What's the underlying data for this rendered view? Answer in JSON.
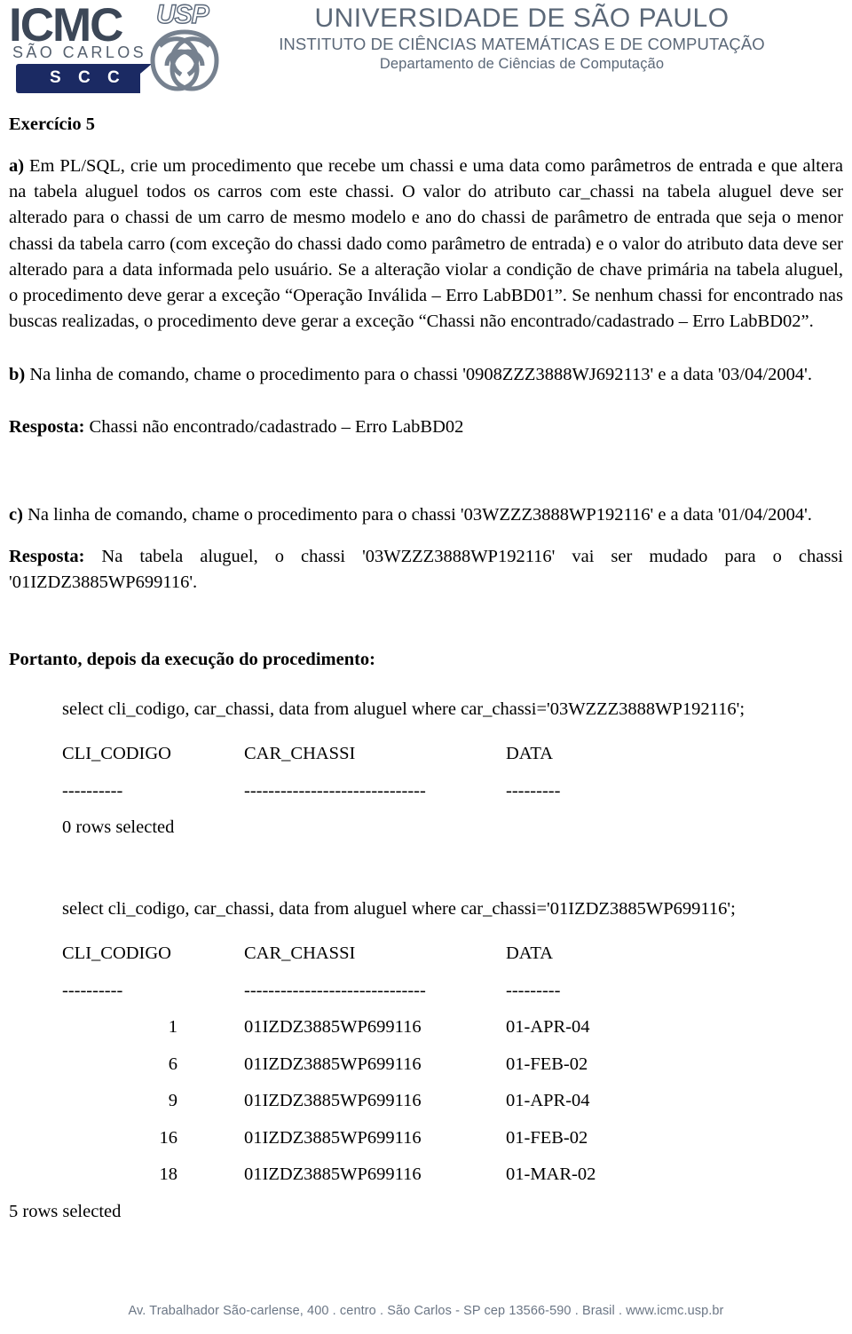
{
  "header": {
    "logo": {
      "icmc": "ICMC",
      "campus": "SÃO CARLOS",
      "department_badge": "S C C",
      "usp": "USP"
    },
    "line1": "UNIVERSIDADE DE SÃO PAULO",
    "line2": "INSTITUTO DE CIÊNCIAS MATEMÁTICAS E DE COMPUTAÇÃO",
    "line3": "Departamento de Ciências de Computação",
    "colors": {
      "title_gray_blue": "#5b6878",
      "logo_navy": "#1b2a63",
      "logo_slate": "#3c4757"
    }
  },
  "exercise": {
    "title": "Exercício 5",
    "item_a": {
      "label": "a)",
      "text": " Em PL/SQL, crie um procedimento que recebe um chassi e uma data como parâmetros de entrada e que altera na tabela aluguel todos os carros com este chassi. O valor do atributo car_chassi na tabela aluguel deve ser alterado para o chassi de um carro de mesmo modelo e ano do chassi de parâmetro de entrada que seja o menor chassi da tabela carro (com exceção do chassi dado como parâmetro de entrada) e o valor do atributo data deve ser alterado para a data informada pelo usuário. Se a alteração violar a condição de chave primária na tabela aluguel, o procedimento deve gerar a exceção “Operação Inválida – Erro LabBD01”. Se nenhum chassi for encontrado nas buscas realizadas, o procedimento deve gerar a exceção “Chassi não encontrado/cadastrado – Erro LabBD02”."
    },
    "item_b": {
      "label": "b)",
      "text": " Na linha de comando, chame o procedimento para o chassi  '0908ZZZ3888WJ692113' e a data '03/04/2004'.",
      "answer_label": "Resposta:",
      "answer_text": " Chassi não encontrado/cadastrado – Erro LabBD02"
    },
    "item_c": {
      "label": "c)",
      "text": " Na linha de comando, chame o procedimento para o chassi '03WZZZ3888WP192116' e a data '01/04/2004'.",
      "answer_label": "Resposta:",
      "answer_text": " Na tabela aluguel, o chassi '03WZZZ3888WP192116' vai ser mudado para o chassi '01IZDZ3885WP699116'."
    },
    "after_note": "Portanto, depois da execução do procedimento:"
  },
  "query1": {
    "statement": "select cli_codigo, car_chassi, data from aluguel where car_chassi='03WZZZ3888WP192116';",
    "headers": [
      "CLI_CODIGO",
      "CAR_CHASSI",
      "DATA"
    ],
    "rules": [
      "----------",
      "------------------------------",
      "---------"
    ],
    "rows": [],
    "footer": "0 rows selected"
  },
  "query2": {
    "statement": "select cli_codigo, car_chassi, data  from aluguel where car_chassi='01IZDZ3885WP699116';",
    "headers": [
      "CLI_CODIGO",
      "CAR_CHASSI",
      "DATA"
    ],
    "rules": [
      "----------",
      "------------------------------",
      "---------"
    ],
    "rows": [
      [
        "1",
        "01IZDZ3885WP699116",
        "01-APR-04"
      ],
      [
        "6",
        "01IZDZ3885WP699116",
        "01-FEB-02"
      ],
      [
        "9",
        "01IZDZ3885WP699116",
        "01-APR-04"
      ],
      [
        "16",
        "01IZDZ3885WP699116",
        "01-FEB-02"
      ],
      [
        "18",
        "01IZDZ3885WP699116",
        "01-MAR-02"
      ]
    ],
    "footer": "5 rows selected"
  },
  "footer": {
    "address": "Av. Trabalhador São-carlense, 400 . centro . São Carlos - SP   cep 13566-590 . Brasil . www.icmc.usp.br"
  }
}
